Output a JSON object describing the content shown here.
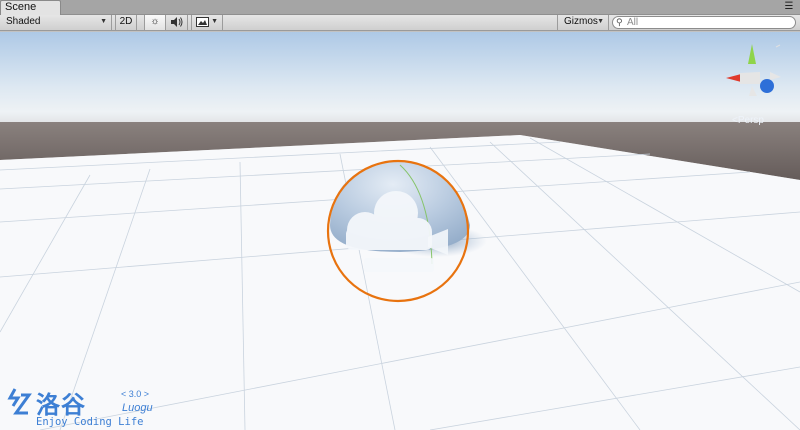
{
  "tabs": [
    {
      "label": "Scene"
    }
  ],
  "tab_menu_icon": "menu-icon",
  "toolbar": {
    "draw_mode": "Shaded",
    "mode_2d": "2D",
    "lighting_icon": "sun-icon",
    "audio_icon": "speaker-icon",
    "effects_icon": "image-icon",
    "gizmos_label": "Gizmos",
    "search_placeholder": "All",
    "search_icon": "search-icon"
  },
  "scene": {
    "projection_label": "Persp",
    "gizmo_axes": [
      "x-axis-red",
      "y-axis-green",
      "z-axis-blue"
    ]
  },
  "watermark": {
    "logo_text": "洛谷",
    "version": "< 3.0 >",
    "brand": "Luogu",
    "tagline": "Enjoy Coding Life"
  },
  "colors": {
    "selection_outline": "#e8730f",
    "sky_top": "#b5cfe8",
    "horizon": "#6f6663",
    "ground": "#f7f8fa",
    "watermark": "#3d7fd4"
  }
}
